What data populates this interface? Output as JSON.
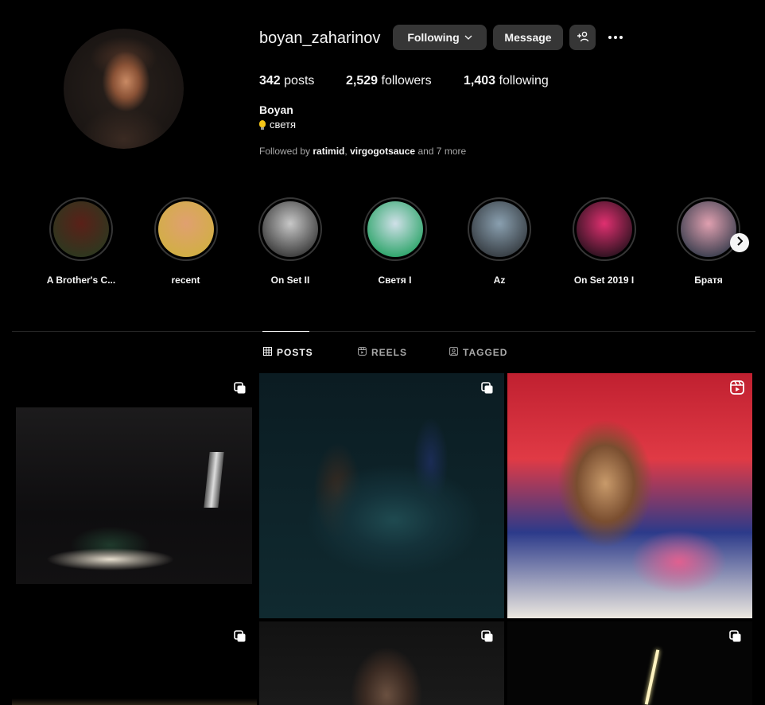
{
  "profile": {
    "username": "boyan_zaharinov",
    "following_label": "Following",
    "message_label": "Message",
    "posts_count": "342",
    "posts_label": "posts",
    "followers_count": "2,529",
    "followers_label": "followers",
    "following_count": "1,403",
    "following_count_label": "following",
    "full_name": "Boyan",
    "bio": "светя",
    "followed_by_prefix": "Followed by",
    "followed_by_users": "ratimid",
    "followed_by_sep": ",",
    "followed_by_users2": "virgogotsauce",
    "followed_by_suffix": "and 7 more"
  },
  "highlights": [
    {
      "label": "A Brother's C...",
      "color_a": "#5a2018",
      "color_b": "#2a3a20"
    },
    {
      "label": "recent",
      "color_a": "#e0a070",
      "color_b": "#d0b040"
    },
    {
      "label": "On Set II",
      "color_a": "#c8c8c8",
      "color_b": "#303030"
    },
    {
      "label": "Светя I",
      "color_a": "#d0e0e8",
      "color_b": "#20a060"
    },
    {
      "label": "Az",
      "color_a": "#8aa0b0",
      "color_b": "#30353a"
    },
    {
      "label": "On Set 2019 I",
      "color_a": "#e03070",
      "color_b": "#20101a"
    },
    {
      "label": "Братя",
      "color_a": "#e0a0b0",
      "color_b": "#303848"
    }
  ],
  "tabs": {
    "posts": "POSTS",
    "reels": "REELS",
    "tagged": "TAGGED"
  },
  "icons": {
    "more": "more-options-icon",
    "add_user": "add-user-icon",
    "multi_post": "carousel-icon",
    "reel": "reel-icon"
  }
}
